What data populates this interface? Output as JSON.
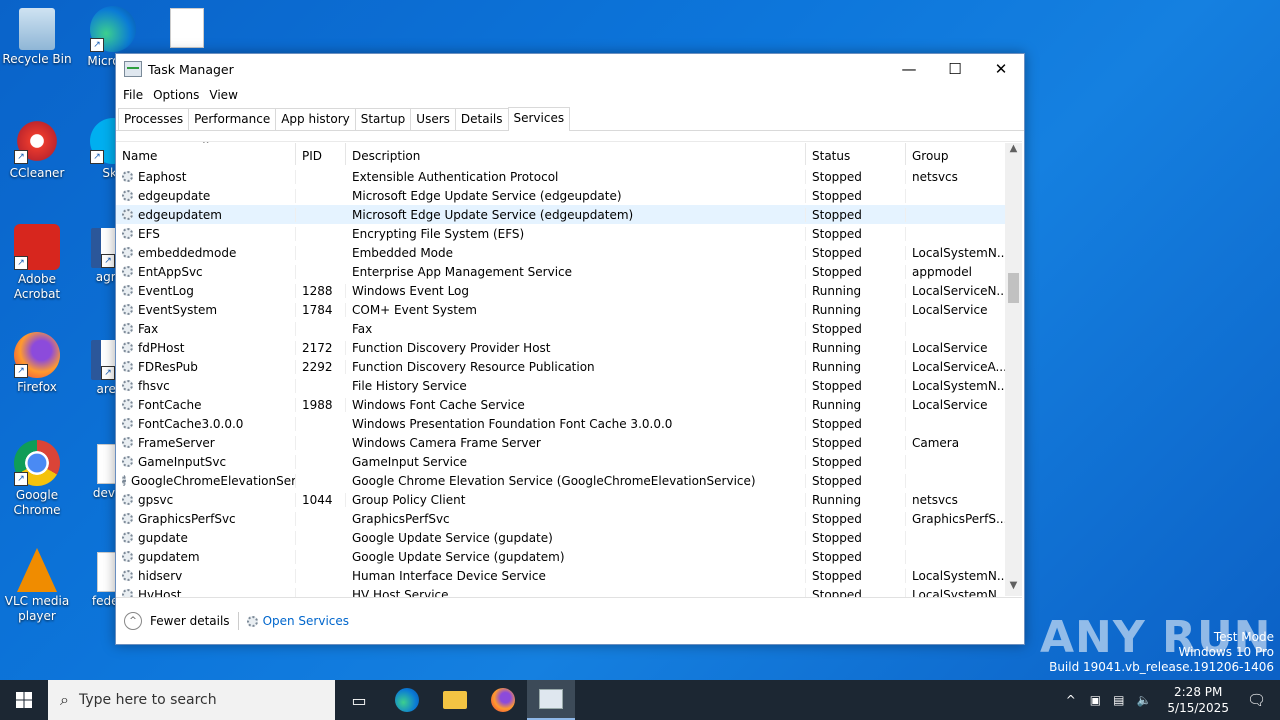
{
  "desktop": {
    "icons": [
      {
        "label": "Recycle Bin",
        "name": "recycle-bin"
      },
      {
        "label": "Micro Ed",
        "name": "edge"
      },
      {
        "label": "",
        "name": "image-file"
      },
      {
        "label": "CCleaner",
        "name": "ccleaner"
      },
      {
        "label": "Sky",
        "name": "skype"
      },
      {
        "label": "Adobe Acrobat",
        "name": "acrobat"
      },
      {
        "label": "agree",
        "name": "word-doc-agree"
      },
      {
        "label": "Firefox",
        "name": "firefox"
      },
      {
        "label": "areas",
        "name": "word-doc-areas"
      },
      {
        "label": "Google Chrome",
        "name": "chrome"
      },
      {
        "label": "develo",
        "name": "file-develo"
      },
      {
        "label": "VLC media player",
        "name": "vlc"
      },
      {
        "label": "federal",
        "name": "file-federal"
      }
    ]
  },
  "window": {
    "title": "Task Manager",
    "controls": {
      "minimize": "—",
      "maximize": "☐",
      "close": "✕"
    }
  },
  "menu": [
    "File",
    "Options",
    "View"
  ],
  "tabs": [
    "Processes",
    "Performance",
    "App history",
    "Startup",
    "Users",
    "Details",
    "Services"
  ],
  "active_tab": "Services",
  "columns": {
    "name": "Name",
    "pid": "PID",
    "description": "Description",
    "status": "Status",
    "group": "Group"
  },
  "services": [
    {
      "name": "Eaphost",
      "pid": "",
      "description": "Extensible Authentication Protocol",
      "status": "Stopped",
      "group": "netsvcs"
    },
    {
      "name": "edgeupdate",
      "pid": "",
      "description": "Microsoft Edge Update Service (edgeupdate)",
      "status": "Stopped",
      "group": ""
    },
    {
      "name": "edgeupdatem",
      "pid": "",
      "description": "Microsoft Edge Update Service (edgeupdatem)",
      "status": "Stopped",
      "group": ""
    },
    {
      "name": "EFS",
      "pid": "",
      "description": "Encrypting File System (EFS)",
      "status": "Stopped",
      "group": ""
    },
    {
      "name": "embeddedmode",
      "pid": "",
      "description": "Embedded Mode",
      "status": "Stopped",
      "group": "LocalSystemN..."
    },
    {
      "name": "EntAppSvc",
      "pid": "",
      "description": "Enterprise App Management Service",
      "status": "Stopped",
      "group": "appmodel"
    },
    {
      "name": "EventLog",
      "pid": "1288",
      "description": "Windows Event Log",
      "status": "Running",
      "group": "LocalServiceN..."
    },
    {
      "name": "EventSystem",
      "pid": "1784",
      "description": "COM+ Event System",
      "status": "Running",
      "group": "LocalService"
    },
    {
      "name": "Fax",
      "pid": "",
      "description": "Fax",
      "status": "Stopped",
      "group": ""
    },
    {
      "name": "fdPHost",
      "pid": "2172",
      "description": "Function Discovery Provider Host",
      "status": "Running",
      "group": "LocalService"
    },
    {
      "name": "FDResPub",
      "pid": "2292",
      "description": "Function Discovery Resource Publication",
      "status": "Running",
      "group": "LocalServiceA..."
    },
    {
      "name": "fhsvc",
      "pid": "",
      "description": "File History Service",
      "status": "Stopped",
      "group": "LocalSystemN..."
    },
    {
      "name": "FontCache",
      "pid": "1988",
      "description": "Windows Font Cache Service",
      "status": "Running",
      "group": "LocalService"
    },
    {
      "name": "FontCache3.0.0.0",
      "pid": "",
      "description": "Windows Presentation Foundation Font Cache 3.0.0.0",
      "status": "Stopped",
      "group": ""
    },
    {
      "name": "FrameServer",
      "pid": "",
      "description": "Windows Camera Frame Server",
      "status": "Stopped",
      "group": "Camera"
    },
    {
      "name": "GameInputSvc",
      "pid": "",
      "description": "GameInput Service",
      "status": "Stopped",
      "group": ""
    },
    {
      "name": "GoogleChromeElevationSer...",
      "pid": "",
      "description": "Google Chrome Elevation Service (GoogleChromeElevationService)",
      "status": "Stopped",
      "group": ""
    },
    {
      "name": "gpsvc",
      "pid": "1044",
      "description": "Group Policy Client",
      "status": "Running",
      "group": "netsvcs"
    },
    {
      "name": "GraphicsPerfSvc",
      "pid": "",
      "description": "GraphicsPerfSvc",
      "status": "Stopped",
      "group": "GraphicsPerfS..."
    },
    {
      "name": "gupdate",
      "pid": "",
      "description": "Google Update Service (gupdate)",
      "status": "Stopped",
      "group": ""
    },
    {
      "name": "gupdatem",
      "pid": "",
      "description": "Google Update Service (gupdatem)",
      "status": "Stopped",
      "group": ""
    },
    {
      "name": "hidserv",
      "pid": "",
      "description": "Human Interface Device Service",
      "status": "Stopped",
      "group": "LocalSystemN..."
    },
    {
      "name": "HvHost",
      "pid": "",
      "description": "HV Host Service",
      "status": "Stopped",
      "group": "LocalSystemN..."
    }
  ],
  "selected_service": "edgeupdatem",
  "footer": {
    "fewer_details": "Fewer details",
    "open_services": "Open Services"
  },
  "taskbar": {
    "search_placeholder": "Type here to search",
    "time": "2:28 PM",
    "date": "5/15/2025"
  },
  "watermark": {
    "line1": "Test Mode",
    "line2": "Windows 10 Pro",
    "line3": "Build 19041.vb_release.191206-1406",
    "brand": "ANY RUN"
  },
  "colors": {
    "accent": "#0078d7",
    "selection": "#e5f3ff",
    "desktop": "#0d76db",
    "taskbar": "#1c2733"
  }
}
